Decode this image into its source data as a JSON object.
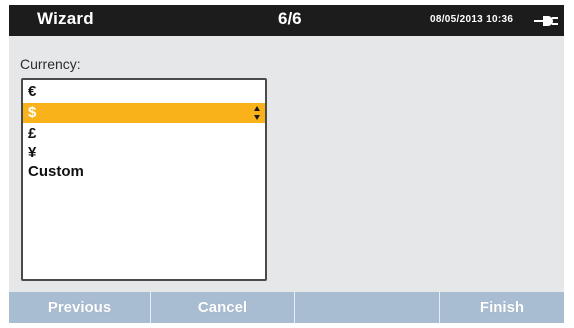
{
  "header": {
    "title": "Wizard",
    "step": "6/6",
    "datetime": "08/05/2013 10:36",
    "power_icon": "ac-plug-icon"
  },
  "form": {
    "label": "Currency:",
    "options": [
      "€",
      "$",
      "£",
      "¥",
      "Custom"
    ],
    "selected_index": 1,
    "selected_value": "$"
  },
  "softkeys": {
    "previous": "Previous",
    "cancel": "Cancel",
    "empty": "",
    "finish": "Finish"
  },
  "colors": {
    "titlebar": "#1c1c1c",
    "selection": "#f9b21a",
    "softkey_bar": "#a8bcd2",
    "background": "#e6e7e9"
  }
}
